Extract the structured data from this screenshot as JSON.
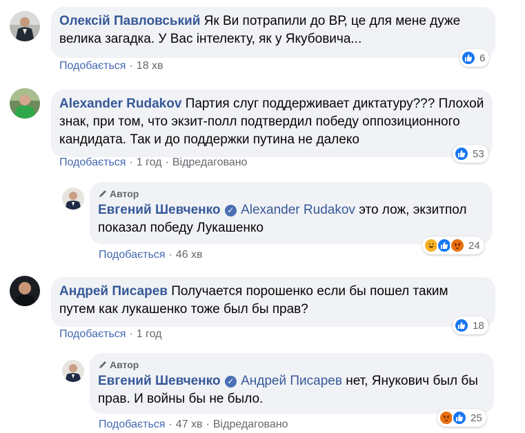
{
  "comments": [
    {
      "author": "Олексій Павловський",
      "text": "Як Ви потрапили до ВР, це для мене дуже велика загадка. У Вас інтелекту, як у Якубовича...",
      "like_label": "Подобається",
      "time": "18 хв",
      "reactions": [
        "like"
      ],
      "reaction_count": "6"
    },
    {
      "author": "Alexander Rudakov",
      "text": "Партия слуг поддерживает диктатуру??? Плохой знак, при том, что экзит-полл подтвердил победу оппозиционного кандидата. Так и до поддержки путина не далеко",
      "like_label": "Подобається",
      "time": "1 год",
      "edited": "Відредаговано",
      "reactions": [
        "like"
      ],
      "reaction_count": "53",
      "reply": {
        "badge": "Автор",
        "author": "Евгений Шевченко",
        "mention": "Alexander Rudakov",
        "text": "это лож, экзитпол показал победу Лукашенко",
        "like_label": "Подобається",
        "time": "46 хв",
        "reactions": [
          "haha",
          "like",
          "angry"
        ],
        "reaction_count": "24"
      }
    },
    {
      "author": "Андрей Писарев",
      "text": "Получается порошенко если бы пошел таким путем как лукашенко тоже был бы прав?",
      "like_label": "Подобається",
      "time": "1 год",
      "reactions": [
        "like"
      ],
      "reaction_count": "18",
      "reply": {
        "badge": "Автор",
        "author": "Евгений Шевченко",
        "mention": "Андрей Писарев",
        "text": "нет, Янукович был бы прав. И войны бы не было.",
        "like_label": "Подобається",
        "time": "47 хв",
        "edited": "Відредаговано",
        "reactions": [
          "angry",
          "like"
        ],
        "reaction_count": "25"
      }
    }
  ],
  "icons": {
    "like": "thumbs-up-icon",
    "haha": "laughing-face-icon",
    "angry": "angry-face-icon",
    "verified": "verified-badge-icon",
    "author_badge": "pen-icon"
  },
  "colors": {
    "name": "#365899",
    "link": "#4267b2",
    "bubble": "#f0f2f5",
    "meta": "#65676b",
    "like": "#1877f2"
  }
}
